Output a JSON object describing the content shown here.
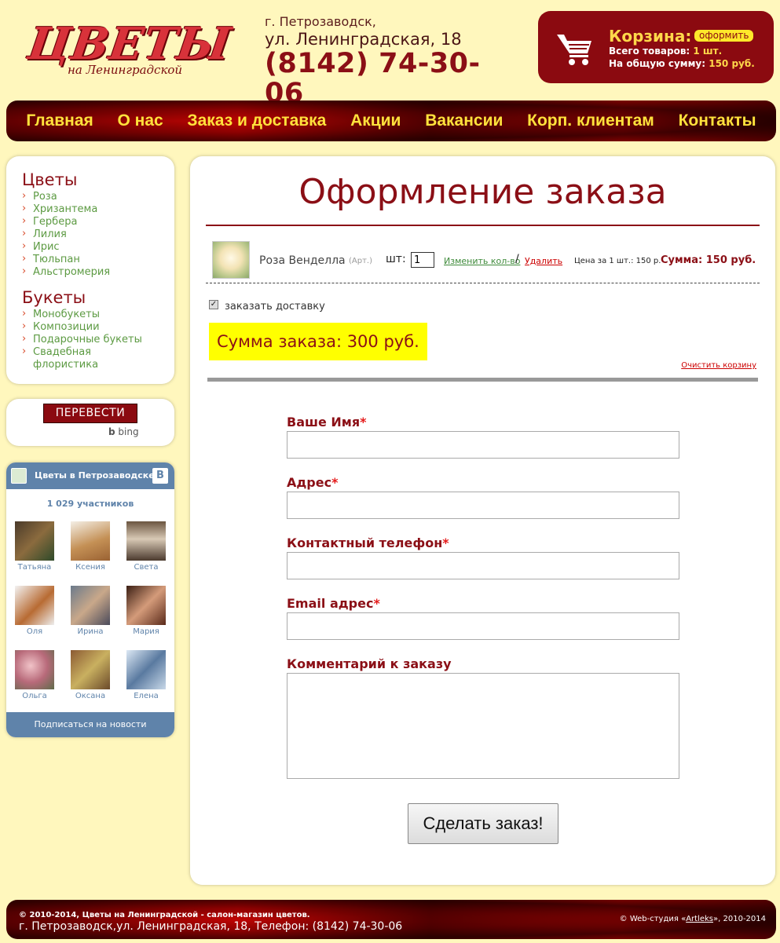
{
  "logo": {
    "main": "ЦВЕТЫ",
    "sub": "на Ленинградской"
  },
  "address": {
    "city": "г. Петрозаводск,",
    "street": "ул. Ленинградская, 18",
    "phone": "(8142) 74-30-06"
  },
  "cart": {
    "title": "Корзина:",
    "checkout_label": "оформить",
    "items_label": "Всего товаров:",
    "items_value": "1 шт.",
    "sum_label": "На общую сумму:",
    "sum_value": "150 руб."
  },
  "nav": [
    "Главная",
    "О нас",
    "Заказ и доставка",
    "Акции",
    "Вакансии",
    "Корп. клиентам",
    "Контакты"
  ],
  "sidebar": {
    "flowers_title": "Цветы",
    "flowers": [
      "Роза",
      "Хризантема",
      "Гербера",
      "Лилия",
      "Ирис",
      "Тюльпан",
      "Альстромерия"
    ],
    "bouquets_title": "Букеты",
    "bouquets": [
      "Монобукеты",
      "Композиции",
      "Подарочные букеты",
      "Свадебная флористика"
    ]
  },
  "translate": {
    "button": "ПЕРЕВЕСТИ",
    "powered": "bing"
  },
  "vk": {
    "title": "Цветы в Петрозаводске",
    "logo": "В",
    "members_count": "1 029 участников",
    "members": [
      "Татьяна",
      "Ксения",
      "Света",
      "Оля",
      "Ирина",
      "Мария",
      "Ольга",
      "Оксана",
      "Елена"
    ],
    "subscribe": "Подписаться на новости"
  },
  "main": {
    "title": "Оформление заказа",
    "item": {
      "name": "Роза Венделла",
      "art": "(Арт.)",
      "qty_label": "шт:",
      "qty": "1",
      "change_qty": "Изменить кол-во",
      "slash": "/",
      "delete": "Удалить",
      "unit_price": "Цена за 1 шт.: 150 р.",
      "sum": "Сумма: 150 руб."
    },
    "delivery_label": "заказать доставку",
    "delivery_checked": true,
    "order_total": "Сумма заказа: 300 руб.",
    "clear_cart": "Очистить корзину",
    "form": {
      "name_label": "Ваше Имя",
      "address_label": "Адрес",
      "phone_label": "Контактный телефон",
      "email_label": "Email адрес",
      "comment_label": "Комментарий к заказу",
      "required_mark": "*",
      "submit": "Сделать заказ!"
    }
  },
  "footer": {
    "copyright": "© 2010-2014, Цветы на Ленинградской - салон-магазин цветов.",
    "address": "г. Петрозаводск,ул. Ленинградская, 18, Телефон: (8142) 74-30-06",
    "studio_prefix": "© Web-студия «",
    "studio_name": "Artleks",
    "studio_suffix": "», 2010-2014"
  }
}
